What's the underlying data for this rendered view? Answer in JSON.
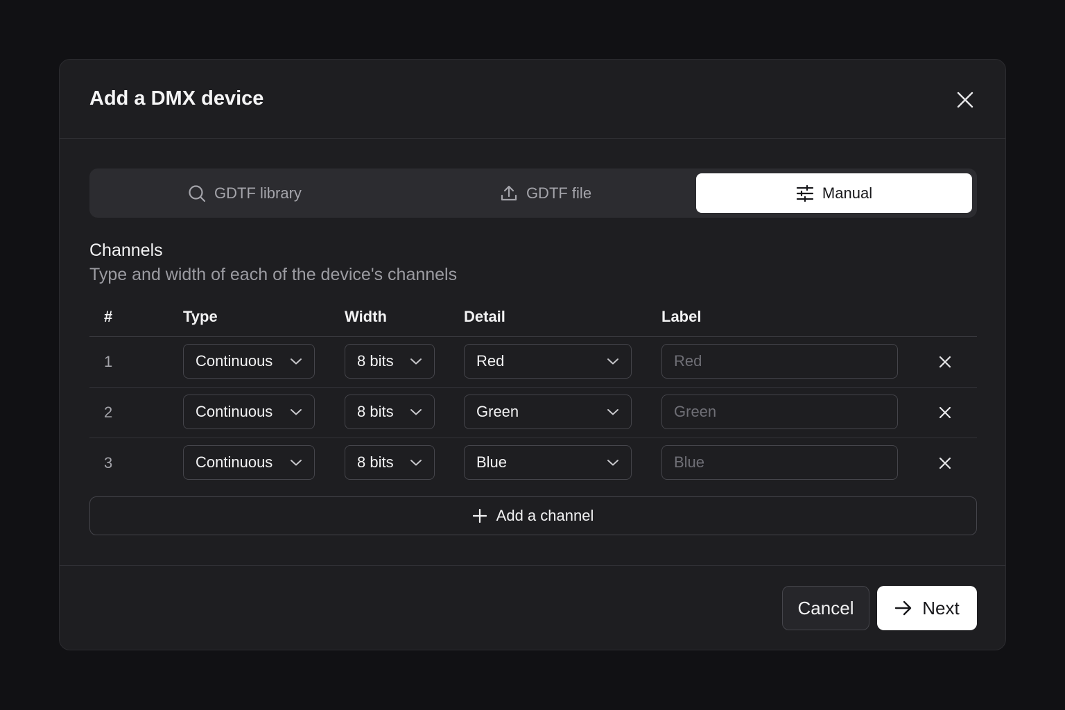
{
  "dialog": {
    "title": "Add a DMX device"
  },
  "tabs": [
    {
      "label": "GDTF library",
      "icon": "search-icon"
    },
    {
      "label": "GDTF file",
      "icon": "upload-icon"
    },
    {
      "label": "Manual",
      "icon": "sliders-icon",
      "active": true
    }
  ],
  "channels": {
    "title": "Channels",
    "subtitle": "Type and width of each of the device's channels",
    "columns": {
      "num": "#",
      "type": "Type",
      "width": "Width",
      "detail": "Detail",
      "label": "Label"
    },
    "rows": [
      {
        "num": "1",
        "type": "Continuous",
        "width": "8 bits",
        "detail": "Red",
        "label_placeholder": "Red"
      },
      {
        "num": "2",
        "type": "Continuous",
        "width": "8 bits",
        "detail": "Green",
        "label_placeholder": "Green"
      },
      {
        "num": "3",
        "type": "Continuous",
        "width": "8 bits",
        "detail": "Blue",
        "label_placeholder": "Blue"
      }
    ],
    "add_label": "Add a channel"
  },
  "footer": {
    "cancel_label": "Cancel",
    "next_label": "Next"
  }
}
